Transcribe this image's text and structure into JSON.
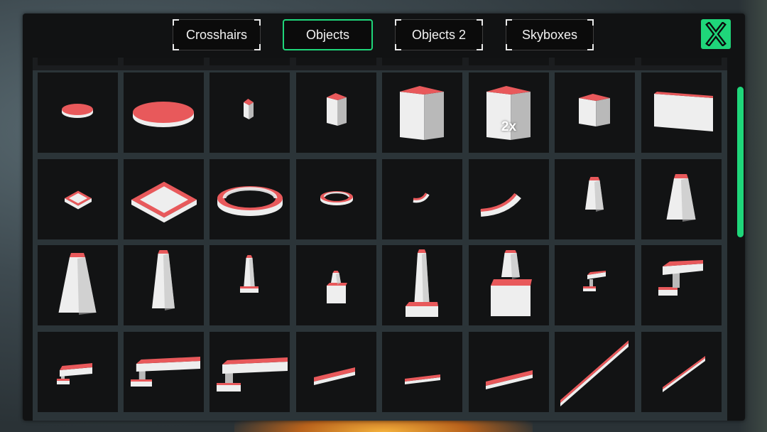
{
  "tabs": [
    {
      "label": "Crosshairs",
      "active": false
    },
    {
      "label": "Objects",
      "active": true
    },
    {
      "label": "Objects 2",
      "active": false
    },
    {
      "label": "Skyboxes",
      "active": false
    }
  ],
  "close_button": {
    "label": "X",
    "icon": "close-icon"
  },
  "colors": {
    "accent": "#1fd67a",
    "object_top": "#e8595b",
    "object_side": "#eeeeee",
    "panel": "#111213",
    "grid": "#2b3438"
  },
  "items": [
    {
      "name": "small-disc"
    },
    {
      "name": "large-disc"
    },
    {
      "name": "thin-pillar"
    },
    {
      "name": "short-pillar"
    },
    {
      "name": "cube"
    },
    {
      "name": "cube",
      "badge": "2x"
    },
    {
      "name": "wall-block"
    },
    {
      "name": "wide-wall"
    },
    {
      "name": "small-square-ring"
    },
    {
      "name": "large-square-ring"
    },
    {
      "name": "large-ring"
    },
    {
      "name": "small-ring"
    },
    {
      "name": "small-arc"
    },
    {
      "name": "large-arc"
    },
    {
      "name": "small-tapered-block"
    },
    {
      "name": "tapered-block"
    },
    {
      "name": "large-tapered-tower"
    },
    {
      "name": "tapered-tower"
    },
    {
      "name": "thin-tower-on-base"
    },
    {
      "name": "small-tower-on-block"
    },
    {
      "name": "tall-tower-on-base"
    },
    {
      "name": "tower-on-block"
    },
    {
      "name": "small-step-platform"
    },
    {
      "name": "step-platform"
    },
    {
      "name": "small-ledge-platform"
    },
    {
      "name": "ledge-platform"
    },
    {
      "name": "large-ledge-platform"
    },
    {
      "name": "small-flat-plank"
    },
    {
      "name": "flat-plank"
    },
    {
      "name": "long-flat-plank"
    },
    {
      "name": "long-rail"
    },
    {
      "name": "short-rail"
    }
  ]
}
